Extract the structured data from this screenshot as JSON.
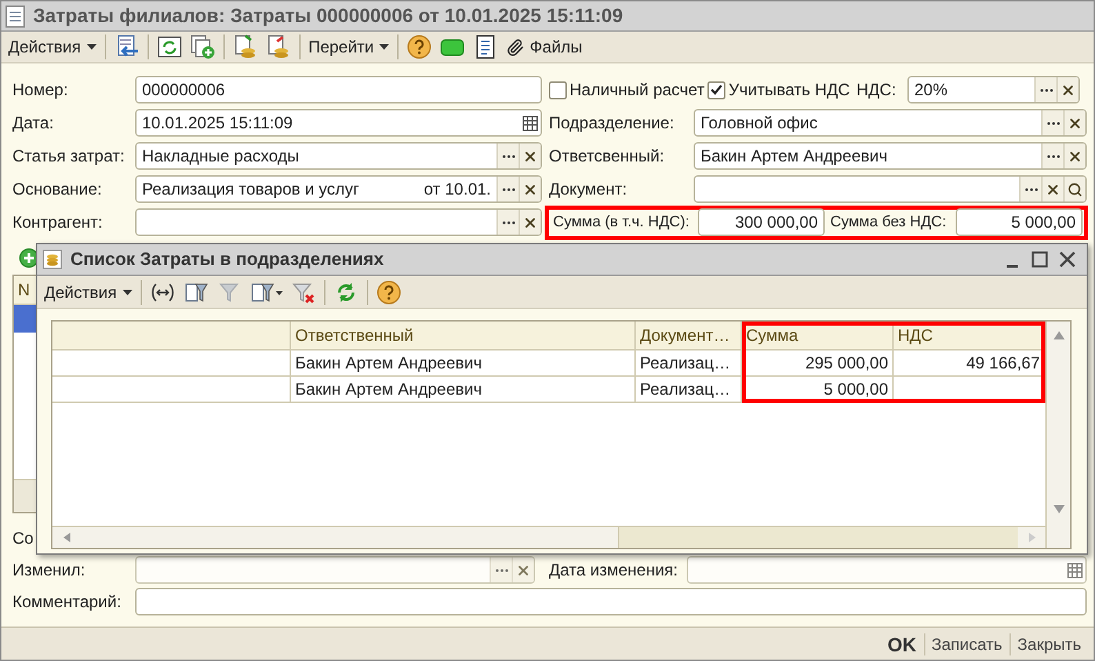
{
  "window": {
    "title": "Затраты филиалов: Затраты 000000006 от 10.01.2025 15:11:09"
  },
  "toolbar": {
    "actions": "Действия",
    "goto": "Перейти",
    "files": "Файлы"
  },
  "form": {
    "number": {
      "label": "Номер:",
      "value": "000000006"
    },
    "checkboxes": [
      {
        "label": "Наличный расчет",
        "checked": false
      },
      {
        "label": "Учитывать НДС",
        "checked": true
      }
    ],
    "vat_rate": {
      "label": "НДС:",
      "value": "20%",
      "kind": "reference"
    },
    "left_fields": [
      {
        "label": "Дата:",
        "value": "10.01.2025 15:11:09",
        "kind": "date"
      },
      {
        "label": "Статья затрат:",
        "value": "Накладные расходы",
        "kind": "reference"
      },
      {
        "label": "Основание:",
        "value": "Реализация товаров и услуг",
        "suffix": "от 10.01.",
        "kind": "reference"
      },
      {
        "label": "Контрагент:",
        "kind": "reference"
      }
    ],
    "right_fields": [
      {
        "label": "Подразделение:",
        "value": "Головной офис",
        "kind": "reference"
      },
      {
        "label": "Ответсвенный:",
        "value": "Бакин Артем Андреевич",
        "kind": "reference"
      },
      {
        "label": "Документ:",
        "kind": "reference_search"
      }
    ],
    "sum_row": {
      "highlighted": true,
      "total_label": "Сумма (в т.ч. НДС):",
      "total": "300 000,00",
      "net_label": "Сумма без НДС:",
      "net": "5 000,00"
    },
    "lines_table": {
      "column_1": "N"
    },
    "partial_label": "Со",
    "changed_by": {
      "label": "Изменил:",
      "kind": "reference"
    },
    "changed_at": {
      "label": "Дата изменения:",
      "kind": "date"
    },
    "comment": {
      "label": "Комментарий:"
    }
  },
  "buttons": [
    {
      "label": "OK",
      "default": true
    },
    {
      "label": "Записать",
      "default": false
    },
    {
      "label": "Закрыть",
      "default": false
    }
  ],
  "dialog": {
    "title": "Список Затраты в подразделениях",
    "actions": "Действия",
    "table": {
      "columns": [
        {
          "label": "Ответственный",
          "kind": "text",
          "highlighted": false
        },
        {
          "label": "Документ…",
          "kind": "text",
          "highlighted": false
        },
        {
          "label": "Сумма",
          "kind": "number",
          "highlighted": true
        },
        {
          "label": "НДС",
          "kind": "number",
          "highlighted": true
        }
      ],
      "rows": [
        {
          "cells": [
            "Бакин Артем Андреевич",
            "Реализац…",
            "295 000,00",
            "49 166,67"
          ]
        },
        {
          "cells": [
            "Бакин Артем Андреевич",
            "Реализац…",
            "5 000,00"
          ]
        }
      ]
    }
  }
}
